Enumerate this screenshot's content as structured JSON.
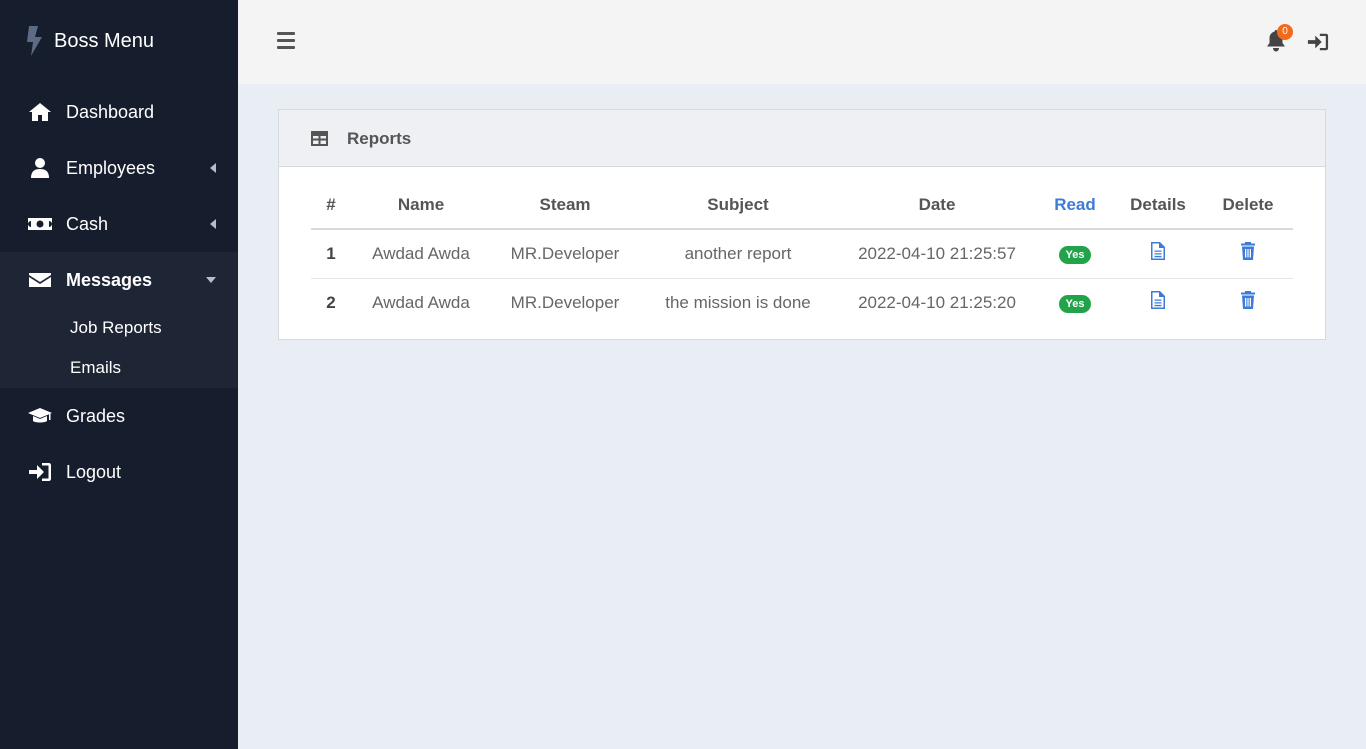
{
  "brand": {
    "title": "Boss Menu",
    "icon": "bolt-icon"
  },
  "sidebar": {
    "items": [
      {
        "label": "Dashboard",
        "icon": "home-icon"
      },
      {
        "label": "Employees",
        "icon": "user-icon"
      },
      {
        "label": "Cash",
        "icon": "money-bill-icon"
      },
      {
        "label": "Messages",
        "icon": "envelope-icon"
      },
      {
        "label": "Grades",
        "icon": "graduation-cap-icon"
      },
      {
        "label": "Logout",
        "icon": "sign-out-icon"
      }
    ],
    "submenu": [
      {
        "label": "Job Reports"
      },
      {
        "label": "Emails"
      }
    ]
  },
  "topbar": {
    "notification_count": "0"
  },
  "card": {
    "title": "Reports",
    "columns": [
      "#",
      "Name",
      "Steam",
      "Subject",
      "Date",
      "Read",
      "Details",
      "Delete"
    ],
    "rows": [
      {
        "num": "1",
        "name": "Awdad Awda",
        "steam": "MR.Developer",
        "subject": "another report",
        "date": "2022-04-10 21:25:57",
        "read": "Yes"
      },
      {
        "num": "2",
        "name": "Awdad Awda",
        "steam": "MR.Developer",
        "subject": "the mission is done",
        "date": "2022-04-10 21:25:20",
        "read": "Yes"
      }
    ]
  },
  "colors": {
    "sidebar_bg": "#161d2c",
    "accent": "#3d7bd8",
    "badge": "#f26a1b",
    "read_yes": "#22a34a"
  }
}
